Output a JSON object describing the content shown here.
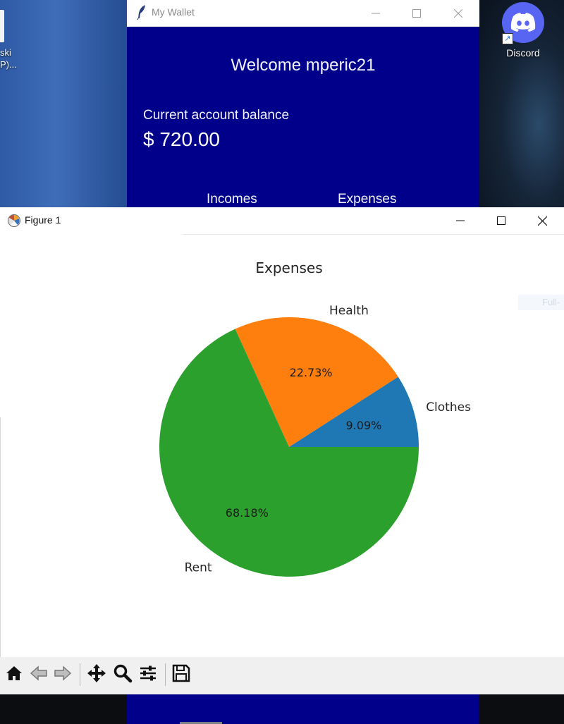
{
  "desktop": {
    "left_icon_text": [
      "ski",
      "P)..."
    ],
    "discord_label": "Discord"
  },
  "wallet_window": {
    "title": "My Wallet",
    "welcome": "Welcome mperic21",
    "balance_label": "Current account balance",
    "balance_value": "$ 720.00",
    "buttons": {
      "incomes": "Incomes",
      "expenses": "Expenses"
    },
    "colors": {
      "background": "#00008b"
    }
  },
  "figure_window": {
    "title": "Figure 1",
    "faded_tag": "Full-",
    "toolbar": [
      "home-icon",
      "back-icon",
      "forward-icon",
      "pan-icon",
      "zoom-icon",
      "configure-subplots-icon",
      "save-icon"
    ]
  },
  "chart_data": {
    "type": "pie",
    "title": "Expenses",
    "labels": [
      "Clothes",
      "Health",
      "Rent"
    ],
    "values": [
      9.09,
      22.73,
      68.18
    ],
    "autopct_labels": [
      "9.09%",
      "22.73%",
      "68.18%"
    ],
    "colors": [
      "#1f77b4",
      "#ff7f0e",
      "#2ca02c"
    ],
    "start_angle": 0,
    "direction": "counterclockwise"
  }
}
